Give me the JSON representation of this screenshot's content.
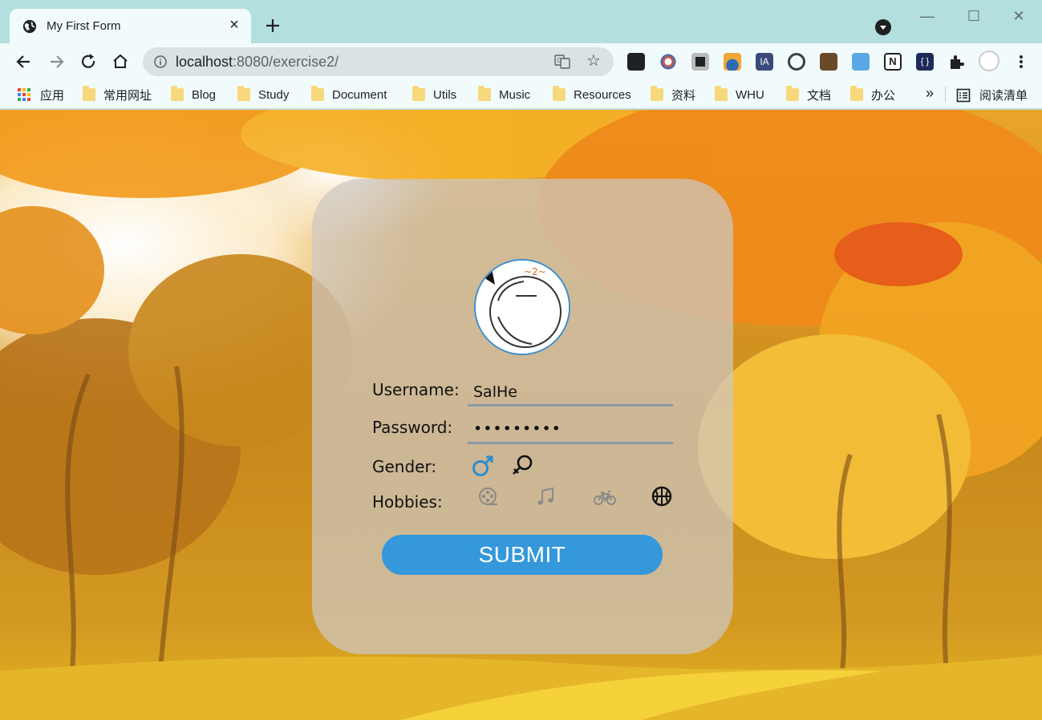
{
  "browser": {
    "tab_title": "My First Form",
    "tab_close": "×",
    "new_tab": "+",
    "url_host": "localhost",
    "url_rest": ":8080/exercise2/",
    "bookmarks": [
      {
        "label": "应用",
        "icon": "apps-grid-icon"
      },
      {
        "label": "常用网址",
        "icon": "folder-icon"
      },
      {
        "label": "Blog",
        "icon": "folder-icon"
      },
      {
        "label": "Study",
        "icon": "folder-icon"
      },
      {
        "label": "Document",
        "icon": "folder-icon"
      },
      {
        "label": "Utils",
        "icon": "folder-icon"
      },
      {
        "label": "Music",
        "icon": "folder-icon"
      },
      {
        "label": "Resources",
        "icon": "folder-icon"
      },
      {
        "label": "资料",
        "icon": "folder-icon"
      },
      {
        "label": "WHU",
        "icon": "folder-icon"
      },
      {
        "label": "文档",
        "icon": "folder-icon"
      },
      {
        "label": "办公",
        "icon": "folder-icon"
      }
    ],
    "bookmarks_more": "»",
    "reading_list": "阅读清单",
    "window_controls": {
      "minimize": "—",
      "maximize": "☐",
      "close": "✕"
    }
  },
  "form": {
    "username_label": "Username:",
    "username_value": "SalHe",
    "password_label": "Password:",
    "password_value": "•••••••••",
    "gender_label": "Gender:",
    "gender_options": [
      {
        "name": "male",
        "icon": "male-icon",
        "selected": true
      },
      {
        "name": "female",
        "icon": "female-icon",
        "selected": false
      }
    ],
    "hobbies_label": "Hobbies:",
    "hobbies": [
      {
        "name": "film",
        "icon": "film-reel-icon",
        "selected": false
      },
      {
        "name": "music",
        "icon": "music-note-icon",
        "selected": false
      },
      {
        "name": "cycling",
        "icon": "bicycle-icon",
        "selected": false
      },
      {
        "name": "basketball",
        "icon": "basketball-icon",
        "selected": true
      }
    ],
    "submit_label": "SUBMIT"
  },
  "colors": {
    "accent": "#3498db",
    "selected_icon": "#2b8ccf",
    "unselected_icon": "#8a8a8a",
    "chrome_title": "#b3dfdf",
    "chrome_toolbar": "#f1fbfb"
  }
}
